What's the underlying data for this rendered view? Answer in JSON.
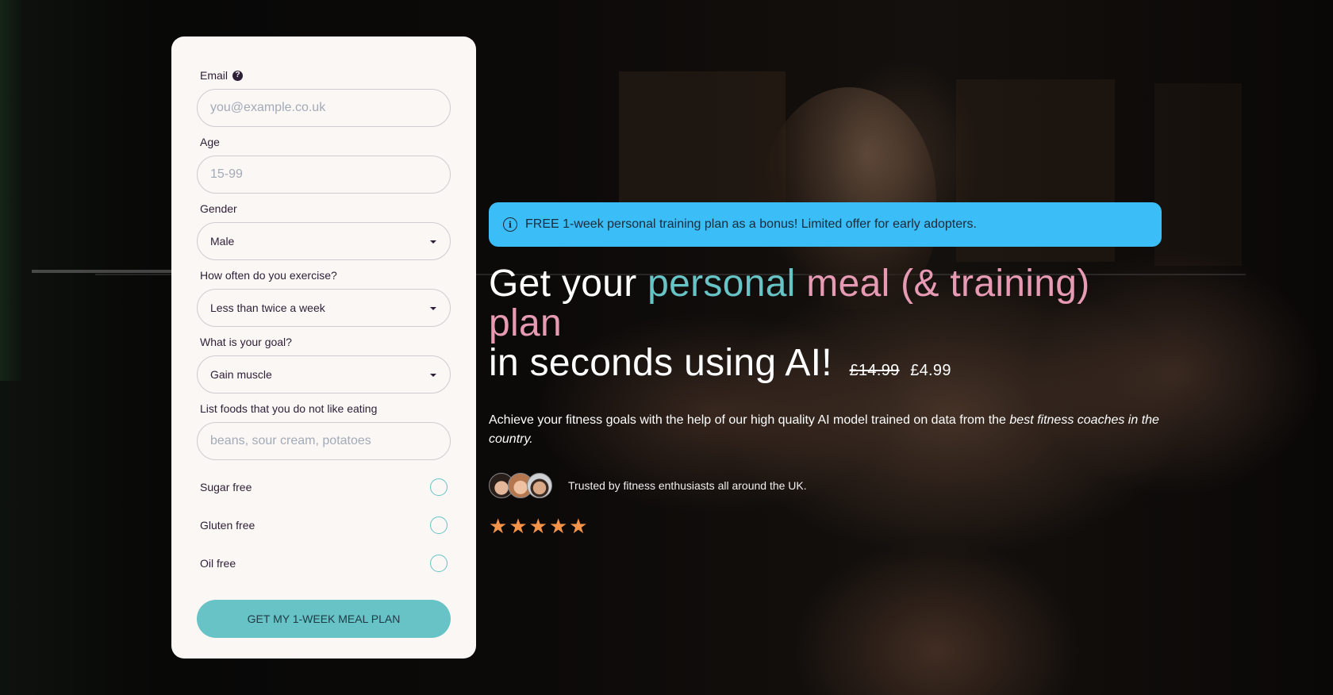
{
  "form": {
    "email": {
      "label": "Email",
      "help_icon": "question-circle-icon",
      "placeholder": "you@example.co.uk",
      "value": ""
    },
    "age": {
      "label": "Age",
      "placeholder": "15-99",
      "value": ""
    },
    "gender": {
      "label": "Gender",
      "selected": "Male"
    },
    "exercise": {
      "label": "How often do you exercise?",
      "selected": "Less than twice a week"
    },
    "goal": {
      "label": "What is your goal?",
      "selected": "Gain muscle"
    },
    "dislikes": {
      "label": "List foods that you do not like eating",
      "placeholder": "beans, sour cream, potatoes",
      "value": ""
    },
    "options": [
      {
        "label": "Sugar free",
        "checked": false
      },
      {
        "label": "Gluten free",
        "checked": false
      },
      {
        "label": "Oil free",
        "checked": false
      }
    ],
    "submit_label": "GET MY 1-WEEK MEAL PLAN"
  },
  "hero": {
    "banner": {
      "icon": "info-circle-icon",
      "text": "FREE 1-week personal training plan as a bonus! Limited offer for early adopters."
    },
    "headline": {
      "part1": "Get your ",
      "part2": "personal",
      "part3": " meal (& training) plan",
      "part4": "in seconds using AI!"
    },
    "price_old": "£14.99",
    "price_new": "£4.99",
    "subtext": {
      "main": "Achieve your fitness goals with the help of our high quality AI model trained on data from the ",
      "emphasis": "best fitness coaches in the country."
    },
    "trust_text": "Trusted by fitness enthusiasts all around the UK.",
    "rating_stars": 5,
    "star_glyph": "★"
  },
  "colors": {
    "accent_teal": "#67c3c5",
    "accent_pink": "#e79ab4",
    "banner_blue": "#3bbef7",
    "star_orange": "#f4934a",
    "card_bg": "#faf7f4",
    "text_dark": "#2d1f37"
  }
}
